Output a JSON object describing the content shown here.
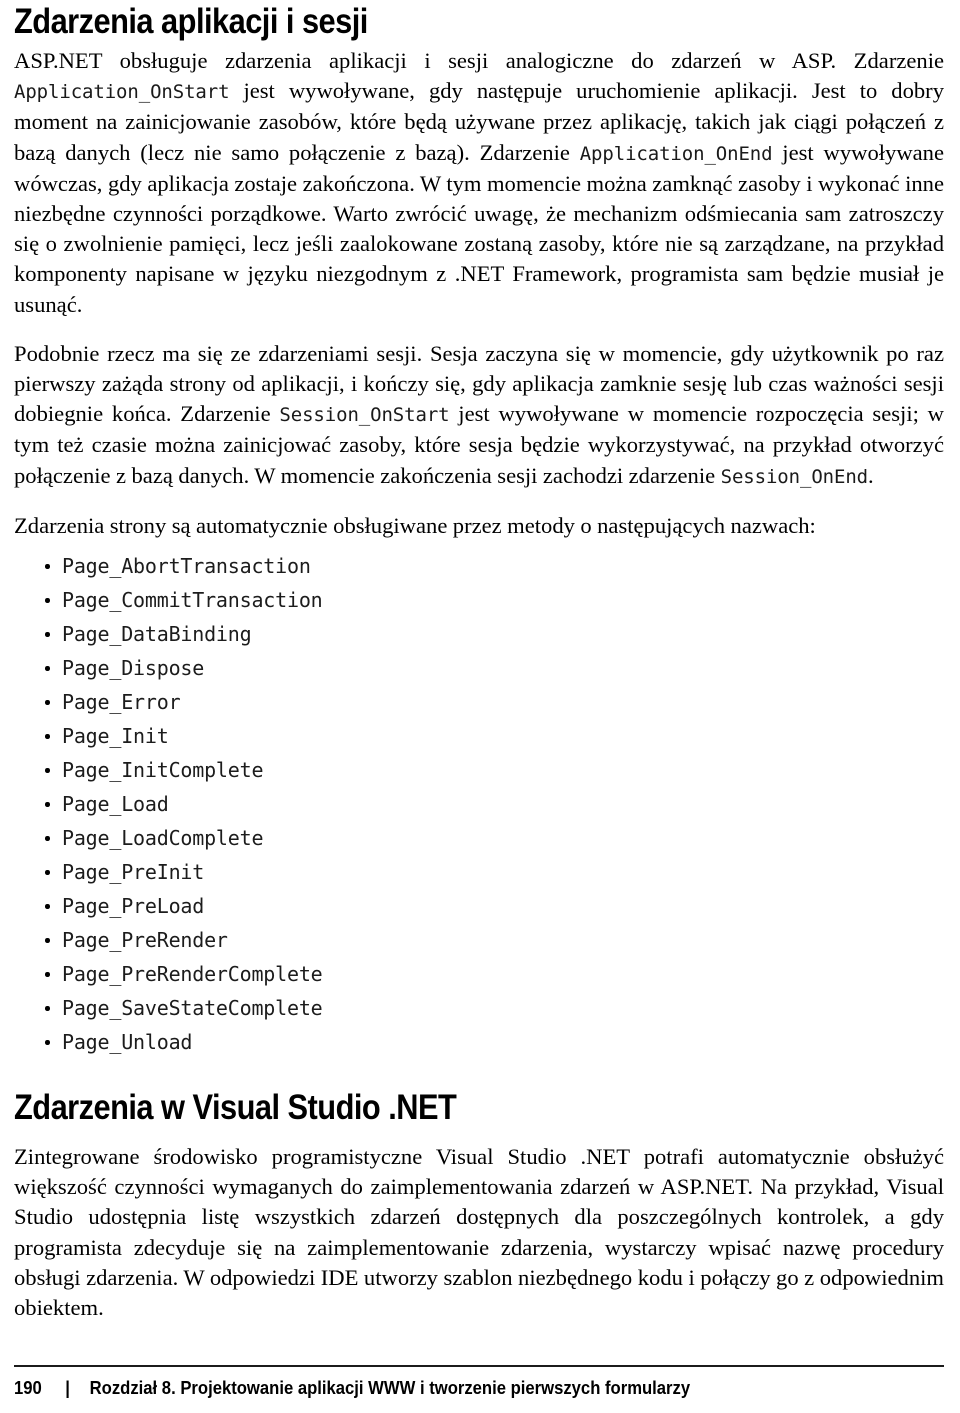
{
  "page": {
    "number": "190",
    "separator": "|",
    "chapter": "Rozdział 8. Projektowanie aplikacji WWW i tworzenie pierwszych formularzy"
  },
  "headings": {
    "h1_first": "Zdarzenia aplikacji i sesji",
    "h1_second": "Zdarzenia w Visual Studio .NET"
  },
  "paragraphs": {
    "p1_a": "ASP.NET obsługuje zdarzenia aplikacji i sesji analogiczne do zdarzeń w ASP. Zdarzenie ",
    "p1_code1": "Application_OnStart",
    "p1_b": " jest wywoływane, gdy następuje uruchomienie aplikacji. Jest to dobry moment na zainicjowanie zasobów, które będą używane przez aplikację, takich jak ciągi połączeń z bazą danych (lecz nie samo połączenie z bazą). Zdarzenie ",
    "p1_code2": "Application_OnEnd",
    "p1_c": " jest wywoływane wówczas, gdy aplikacja zostaje zakończona. W tym momencie można zamknąć zasoby i wykonać inne niezbędne czynności porządkowe. Warto zwrócić uwagę, że mechanizm odśmiecania sam zatroszczy się o zwolnienie pamięci, lecz jeśli zaalokowane zostaną zasoby, które nie są zarządzane, na przykład komponenty napisane w języku niezgodnym z .NET Framework, programista sam będzie musiał je usunąć.",
    "p2_a": "Podobnie rzecz ma się ze zdarzeniami sesji. Sesja zaczyna się w momencie, gdy użytkownik po raz pierwszy zażąda strony od aplikacji, i kończy się, gdy aplikacja zamknie sesję lub czas ważności sesji dobiegnie końca. Zdarzenie ",
    "p2_code1": "Session_OnStart",
    "p2_b": " jest wywoływane w momencie rozpoczęcia sesji; w tym też czasie można zainicjować zasoby, które sesja będzie wykorzystywać, na przykład otworzyć połączenie z bazą danych. W momencie zakończenia sesji zachodzi zdarzenie ",
    "p2_code2": "Session_OnEnd",
    "p2_c": ".",
    "p3": "Zdarzenia strony są automatycznie obsługiwane przez metody o następujących nazwach:",
    "p4": "Zintegrowane środowisko programistyczne Visual Studio .NET potrafi automatycznie obsłużyć większość czynności wymaganych do zaimplementowania zdarzeń w ASP.NET. Na przykład, Visual Studio udostępnia listę wszystkich zdarzeń dostępnych dla poszczególnych kontrolek, a gdy programista zdecyduje się na zaimplementowanie zdarzenia, wystarczy wpisać nazwę procedury obsługi zdarzenia. W odpowiedzi IDE utworzy szablon niezbędnego kodu i połączy go z odpowiednim obiektem."
  },
  "method_list": [
    "Page_AbortTransaction",
    "Page_CommitTransaction",
    "Page_DataBinding",
    "Page_Dispose",
    "Page_Error",
    "Page_Init",
    "Page_InitComplete",
    "Page_Load",
    "Page_LoadComplete",
    "Page_PreInit",
    "Page_PreLoad",
    "Page_PreRender",
    "Page_PreRenderComplete",
    "Page_SaveStateComplete",
    "Page_Unload"
  ],
  "colors": {
    "text": "#000000",
    "code": "#1a1a1a",
    "rule": "#1b1b1b",
    "background": "#ffffff"
  }
}
